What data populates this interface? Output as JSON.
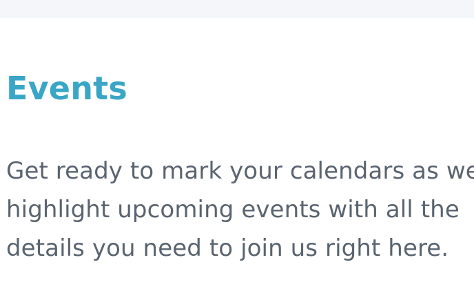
{
  "header": {
    "background_color": "#f4f6f9"
  },
  "events_section": {
    "title": "Events",
    "title_color": "#3aa6c6",
    "text_lines": [
      "Get ready to mark your calendars as we",
      "highlight upcoming events with all the",
      "details you need to join us right here."
    ],
    "text_color": "#5a6470"
  }
}
